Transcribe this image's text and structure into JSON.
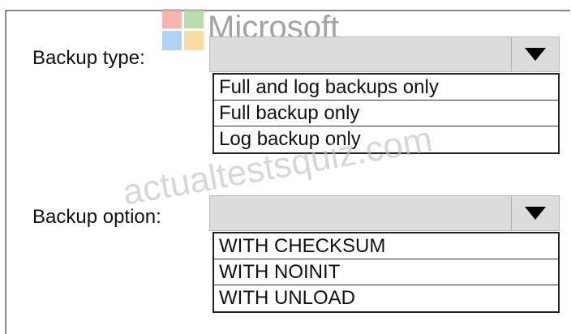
{
  "watermarks": {
    "brand_text": "Microsoft",
    "site_text": "actualtestsquiz.com"
  },
  "backup_type": {
    "label": "Backup type:",
    "selected_value": "",
    "options": [
      "Full and log backups only",
      "Full backup only",
      "Log backup only"
    ]
  },
  "backup_option": {
    "label": "Backup option:",
    "selected_value": "",
    "options": [
      "WITH CHECKSUM",
      "WITH NOINIT",
      "WITH UNLOAD"
    ]
  },
  "icons": {
    "dropdown_arrow": "triangle-down-icon",
    "logo": "microsoft-logo"
  },
  "colors": {
    "dropdown_bg": "#dcdcdc",
    "text": "#111111",
    "border": "#222222"
  }
}
